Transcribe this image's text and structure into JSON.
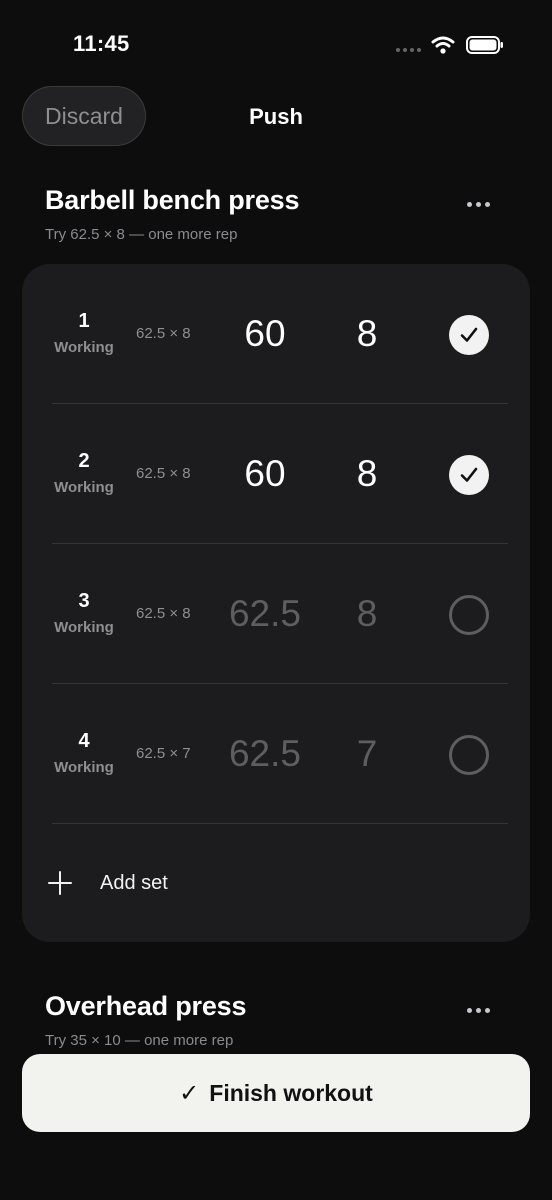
{
  "status": {
    "time": "11:45"
  },
  "header": {
    "discard_label": "Discard",
    "title": "Push"
  },
  "exercises": [
    {
      "title": "Barbell bench press",
      "hint": "Try 62.5 × 8 — one more rep",
      "sets": [
        {
          "number": "1",
          "type": "Working",
          "previous": "62.5 × 8",
          "weight": "60",
          "reps": "8",
          "done": true
        },
        {
          "number": "2",
          "type": "Working",
          "previous": "62.5 × 8",
          "weight": "60",
          "reps": "8",
          "done": true
        },
        {
          "number": "3",
          "type": "Working",
          "previous": "62.5 × 8",
          "weight": "62.5",
          "reps": "8",
          "done": false
        },
        {
          "number": "4",
          "type": "Working",
          "previous": "62.5 × 7",
          "weight": "62.5",
          "reps": "7",
          "done": false
        }
      ],
      "add_set_label": "Add set"
    },
    {
      "title": "Overhead press",
      "hint": "Try 35 × 10 — one more rep"
    }
  ],
  "finish": {
    "label": "Finish workout",
    "icon": "checkmark-icon"
  },
  "colors": {
    "background": "#0d0d0e",
    "card": "#1c1c1e",
    "finish_button": "#f2f2ef"
  }
}
